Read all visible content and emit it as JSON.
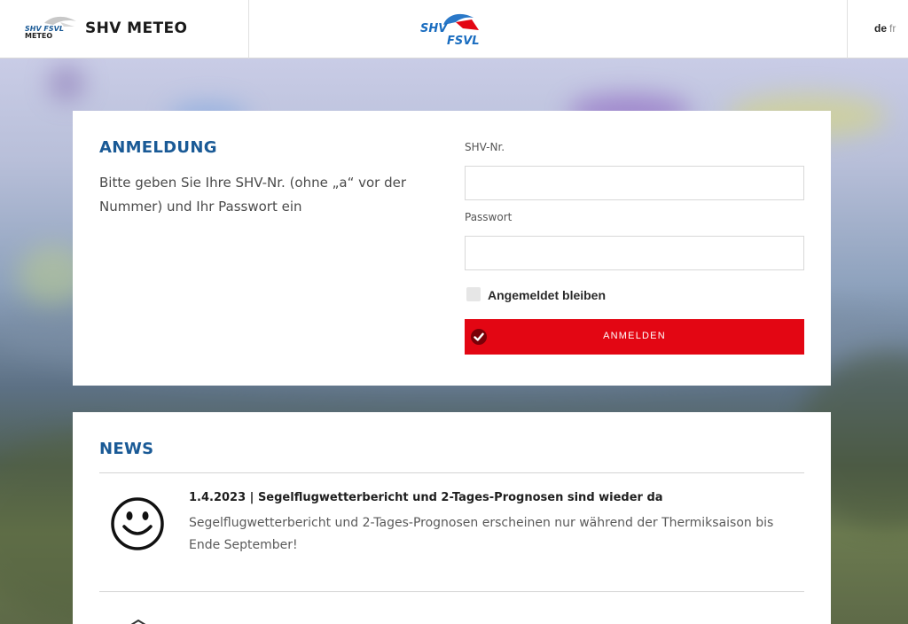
{
  "header": {
    "brand_logo_text_top": "SHV FSVL",
    "brand_logo_text_bottom": "METEO",
    "title": "SHV METEO",
    "center_logo_top": "SHV",
    "center_logo_bottom": "FSVL",
    "languages": [
      "de",
      "fr"
    ],
    "active_language": "de"
  },
  "login": {
    "heading": "ANMELDUNG",
    "intro": "Bitte geben Sie Ihre SHV-Nr. (ohne „a“ vor der Nummer) und Ihr Passwort ein",
    "shv_label": "SHV-Nr.",
    "shv_value": "",
    "password_label": "Passwort",
    "password_value": "",
    "remember_label": "Angemeldet bleiben",
    "remember_checked": false,
    "submit_label": "ANMELDEN",
    "submit_icon": "checkmark-icon"
  },
  "news": {
    "heading": "NEWS",
    "items": [
      {
        "icon": "smiley-icon",
        "title": "1.4.2023 | Segelflugwetterbericht und 2-Tages-Prognosen sind wieder da",
        "body": "Segelflugwetterbericht und 2-Tages-Prognosen erscheinen nur während der Thermiksaison bis Ende September!"
      }
    ]
  },
  "colors": {
    "accent_blue": "#1a5a96",
    "button_red": "#e30613"
  }
}
